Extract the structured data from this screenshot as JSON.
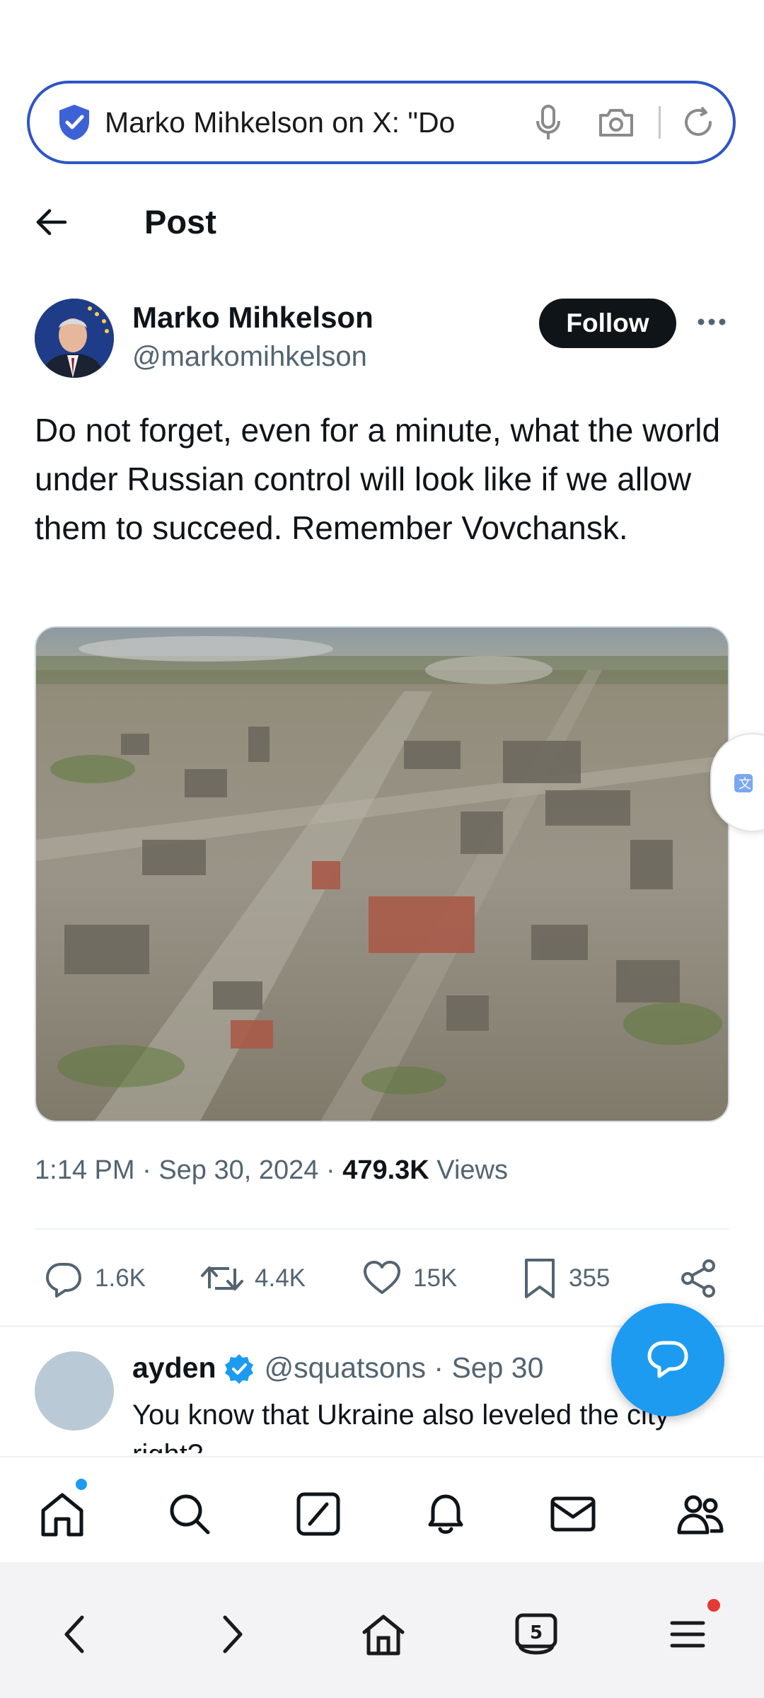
{
  "browser": {
    "address_text": "Marko Mihkelson on X: \"Do"
  },
  "header": {
    "title": "Post"
  },
  "post": {
    "author_name": "Marko Mihkelson",
    "author_handle": "@markomihkelson",
    "follow_label": "Follow",
    "text": "Do not forget, even for a minute, what the world under Russian control will look like if we allow them to succeed. Remember Vovchansk.",
    "time": "1:14 PM",
    "date": "Sep 30, 2024",
    "views_count": "479.3K",
    "views_label": "Views",
    "meta_separator": "·"
  },
  "actions": {
    "replies": "1.6K",
    "reposts": "4.4K",
    "likes": "15K",
    "bookmarks": "355"
  },
  "reply": {
    "name": "ayden",
    "handle_date": "@squatsons · Sep 30",
    "text": "You know that Ukraine also leveled the city right?"
  },
  "browser_tabs_count": "5",
  "colors": {
    "accent": "#1d9bf0",
    "address_border": "#2e55c7",
    "text": "#0f1419",
    "secondary": "#536471"
  }
}
